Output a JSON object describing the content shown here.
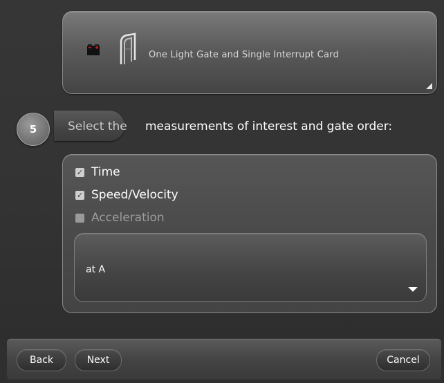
{
  "equipment": {
    "label": "One Light Gate and Single Interrupt Card",
    "battery_icon": "battery-icon",
    "gate_icon": "light-gate-icon"
  },
  "step": {
    "number": "5",
    "select_label": "Select the",
    "instruction": "measurements of interest and gate order:"
  },
  "measurements": {
    "options": [
      {
        "label": "Time",
        "checked": true,
        "enabled": true
      },
      {
        "label": "Speed/Velocity",
        "checked": true,
        "enabled": true
      },
      {
        "label": "Acceleration",
        "checked": false,
        "enabled": false
      }
    ],
    "gate_order": {
      "value": "at A"
    }
  },
  "toolbar": {
    "back_label": "Back",
    "next_label": "Next",
    "cancel_label": "Cancel"
  },
  "colors": {
    "background": "#333333",
    "card": "#5b5b5b",
    "battery_terminal": "#d21c1c"
  }
}
